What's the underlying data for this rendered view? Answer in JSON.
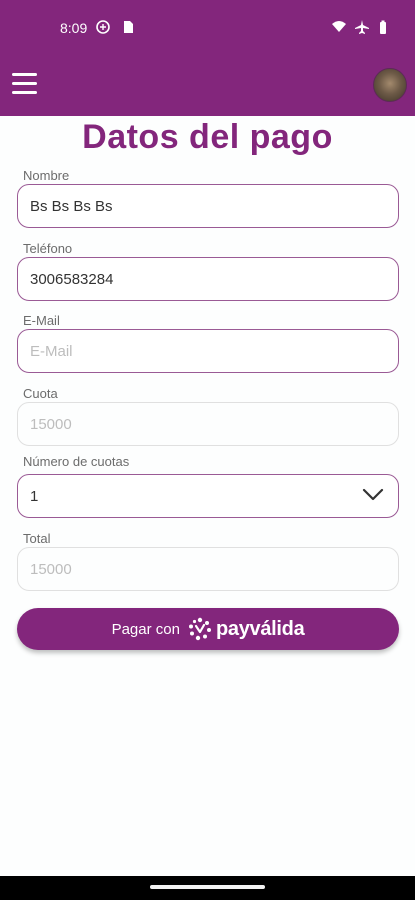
{
  "status_bar": {
    "time": "8:09",
    "icons": [
      "game-controller-icon",
      "sim-card-icon",
      "wifi-icon",
      "airplane-icon",
      "battery-icon"
    ]
  },
  "app_bar": {
    "menu_icon": "hamburger-menu-icon",
    "avatar": "user-avatar"
  },
  "page": {
    "title": "Datos del pago"
  },
  "form": {
    "nombre": {
      "label": "Nombre",
      "value": "Bs Bs Bs Bs"
    },
    "telefono": {
      "label": "Teléfono",
      "value": "3006583284"
    },
    "email": {
      "label": "E-Mail",
      "value": "",
      "placeholder": "E-Mail"
    },
    "cuota": {
      "label": "Cuota",
      "value": "15000"
    },
    "numero_cuotas": {
      "label": "Número de cuotas",
      "selected": "1"
    },
    "total": {
      "label": "Total",
      "value": "15000"
    }
  },
  "pay_button": {
    "label": "Pagar con",
    "brand": "payválida"
  },
  "colors": {
    "primary": "#83267c",
    "field_border": "#9a5a95",
    "disabled_border": "#e0e0e0"
  }
}
